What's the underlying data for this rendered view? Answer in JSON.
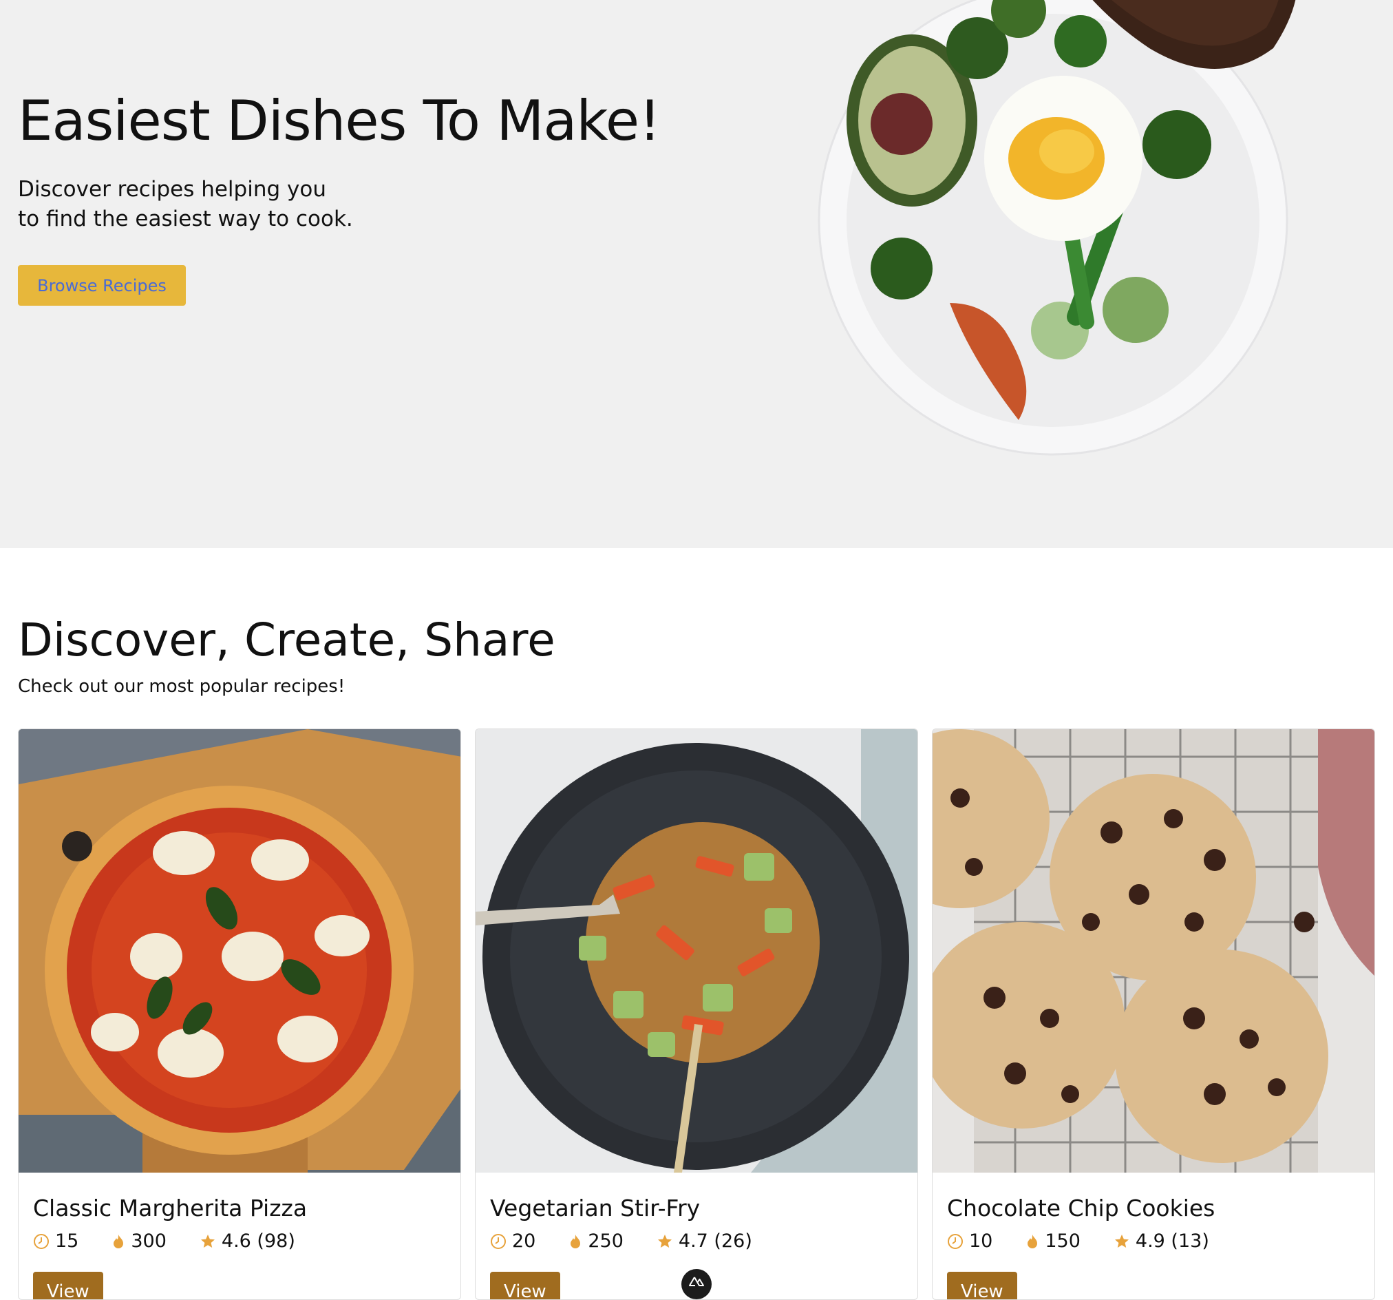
{
  "hero": {
    "title": "Easiest Dishes To Make!",
    "subtitle_line1": "Discover recipes helping you",
    "subtitle_line2": "to find the easiest way to cook.",
    "browse_label": "Browse Recipes"
  },
  "popular": {
    "title": "Discover, Create, Share",
    "subtitle": "Check out our most popular recipes!",
    "view_label": "View",
    "recipes": [
      {
        "name": "Classic Margherita Pizza",
        "time": "15",
        "calories": "300",
        "rating": "4.6 (98)"
      },
      {
        "name": "Vegetarian Stir-Fry",
        "time": "20",
        "calories": "250",
        "rating": "4.7 (26)"
      },
      {
        "name": "Chocolate Chip Cookies",
        "time": "10",
        "calories": "150",
        "rating": "4.9 (13)"
      }
    ]
  },
  "icons": {
    "time": "clock-icon",
    "calories": "flame-icon",
    "rating": "star-icon",
    "badge": "nuxt-logo-icon"
  },
  "colors": {
    "hero_bg": "#f0f0f0",
    "primary_button": "#e7b73b",
    "primary_button_text": "#4a6bd4",
    "view_button": "#a06c1f",
    "icon_accent": "#e7a23b"
  }
}
